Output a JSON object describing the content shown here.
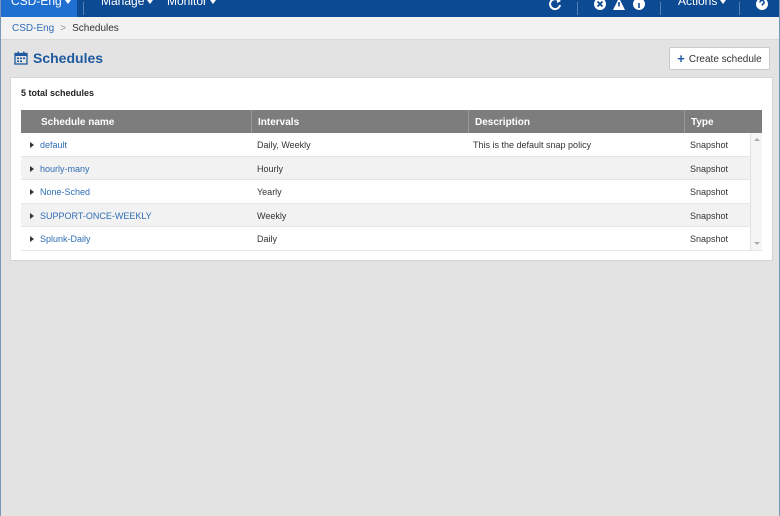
{
  "topnav": {
    "tenant": "CSD-Eng",
    "manage": "Manage",
    "monitor": "Monitor",
    "actions": "Actions"
  },
  "breadcrumb": {
    "root": "CSD-Eng",
    "current": "Schedules"
  },
  "page": {
    "title": "Schedules",
    "create_button": "Create schedule",
    "total_label": "5 total schedules"
  },
  "table": {
    "columns": [
      "Schedule name",
      "Intervals",
      "Description",
      "Type"
    ],
    "rows": [
      {
        "name": "default",
        "intervals": "Daily, Weekly",
        "description": "This is the default snap policy",
        "type": "Snapshot"
      },
      {
        "name": "hourly-many",
        "intervals": "Hourly",
        "description": "",
        "type": "Snapshot"
      },
      {
        "name": "None-Sched",
        "intervals": "Yearly",
        "description": "",
        "type": "Snapshot"
      },
      {
        "name": "SUPPORT-ONCE-WEEKLY",
        "intervals": "Weekly",
        "description": "",
        "type": "Snapshot"
      },
      {
        "name": "Splunk-Daily",
        "intervals": "Daily",
        "description": "",
        "type": "Snapshot"
      }
    ]
  },
  "colors": {
    "nav_bg": "#0d4a94",
    "nav_active": "#1f6fd1",
    "link": "#2f6db5",
    "title": "#1f5aa0",
    "table_header": "#7d7d7d"
  },
  "icons": {
    "refresh": "refresh-icon",
    "close": "close-circle-icon",
    "alert": "alert-triangle-icon",
    "info": "info-icon",
    "help": "help-icon",
    "calendar": "calendar-icon",
    "plus": "plus-icon"
  }
}
